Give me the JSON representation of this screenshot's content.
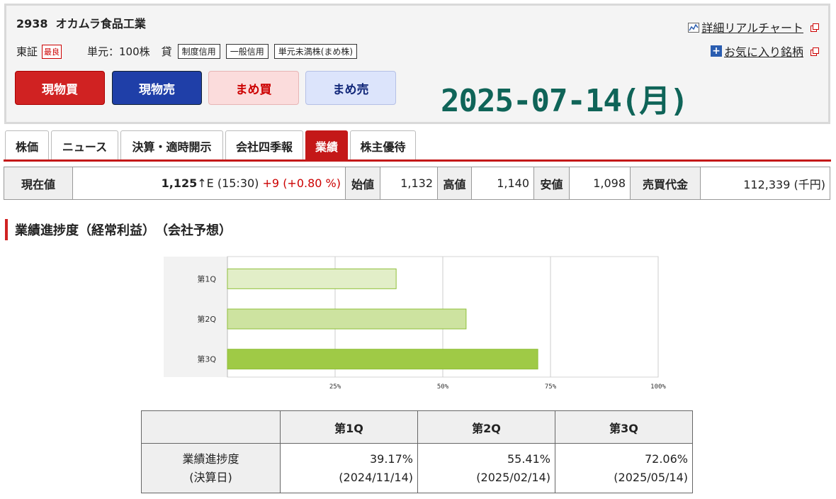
{
  "header": {
    "code": "2938",
    "name": "オカムラ食品工業",
    "market": "東証",
    "market_badge": "最良",
    "unit_label": "単元：100株",
    "kashi": "貸",
    "tags": [
      "制度信用",
      "一般信用",
      "単元未満株(まめ株)"
    ],
    "buttons": [
      "現物買",
      "現物売",
      "まめ買",
      "まめ売"
    ],
    "date": "2025-07-14(月)",
    "links": [
      "詳細リアルチャート",
      "お気に入り銘柄"
    ]
  },
  "tabs": [
    {
      "label": "株価"
    },
    {
      "label": "ニュース"
    },
    {
      "label": "決算・適時開示"
    },
    {
      "label": "会社四季報"
    },
    {
      "label": "業績",
      "active": true
    },
    {
      "label": "株主優待"
    }
  ],
  "price": {
    "current_label": "現在値",
    "current_value": "1,125",
    "arrow": "↑E",
    "time": "(15:30)",
    "change": "+9 (+0.80 %)",
    "open_label": "始値",
    "open_value": "1,132",
    "high_label": "高値",
    "high_value": "1,140",
    "low_label": "安値",
    "low_value": "1,098",
    "turnover_label": "売買代金",
    "turnover_value": "112,339 (千円)"
  },
  "section_title": "業績進捗度（経常利益）　（会社予想）",
  "chart_data": {
    "type": "bar",
    "orientation": "horizontal",
    "categories": [
      "第1Q",
      "第2Q",
      "第3Q"
    ],
    "values": [
      39.17,
      55.41,
      72.06
    ],
    "xlim": [
      0,
      100
    ],
    "xticks": [
      "25%",
      "50%",
      "75%",
      "100%"
    ],
    "colors": [
      "#e2eec8",
      "#cde3a0",
      "#9fca46"
    ],
    "grid": true
  },
  "progress_table": {
    "headers": [
      "第1Q",
      "第2Q",
      "第3Q"
    ],
    "row_label_1": "業績進捗度",
    "row_label_2": "(決算日)",
    "values": [
      "39.17%",
      "55.41%",
      "72.06%"
    ],
    "dates": [
      "(2024/11/14)",
      "(2025/02/14)",
      "(2025/05/14)"
    ]
  }
}
